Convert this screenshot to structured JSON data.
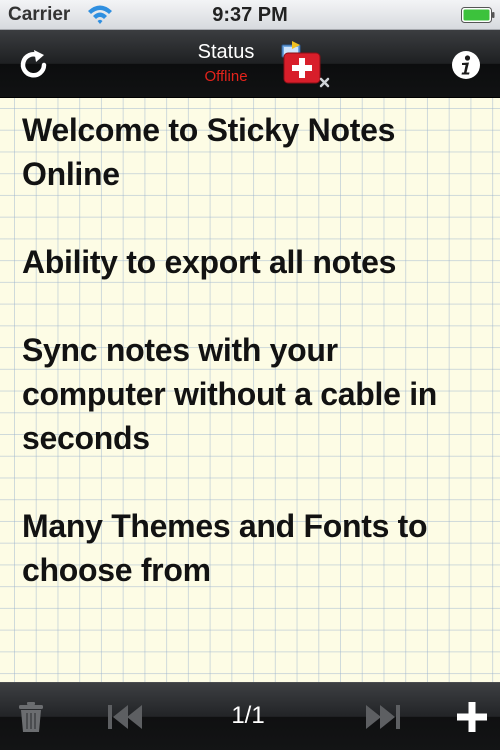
{
  "status_bar": {
    "carrier": "Carrier",
    "time": "9:37 PM",
    "icons": [
      "wifi-icon",
      "battery-icon"
    ]
  },
  "nav_bar": {
    "status_title": "Status",
    "status_value": "Offline",
    "status_color": "#e3231b",
    "icons": [
      "refresh-icon",
      "offline-status-icon",
      "info-icon"
    ]
  },
  "note": {
    "paragraphs": [
      "Welcome to Sticky Notes Online",
      "Ability to export all notes",
      "Sync notes with your computer without a cable in seconds",
      "Many Themes and Fonts to choose from"
    ],
    "paper_color": "#fdfce5"
  },
  "toolbar": {
    "page_indicator": "1/1",
    "icons": [
      "trash-icon",
      "previous-icon",
      "next-icon",
      "add-icon"
    ]
  }
}
